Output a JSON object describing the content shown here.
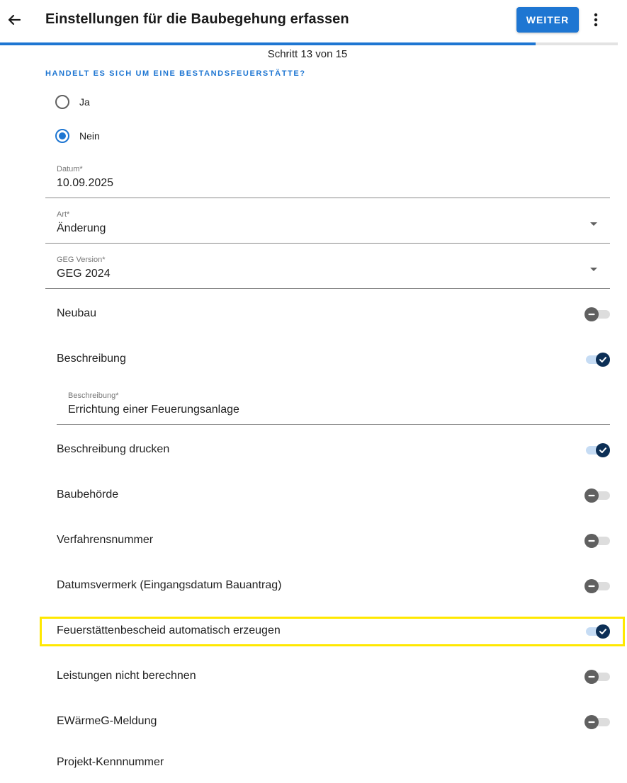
{
  "header": {
    "title": "Einstellungen für die Baubegehung erfassen",
    "weiter_label": "WEITER"
  },
  "progress": {
    "current": 13,
    "total": 15,
    "step_text": "Schritt 13 von 15"
  },
  "question": {
    "label": "HANDELT ES SICH UM EINE BESTANDSFEUERSTÄTTE?",
    "options": [
      {
        "label": "Ja",
        "selected": false
      },
      {
        "label": "Nein",
        "selected": true
      }
    ]
  },
  "fields": {
    "datum": {
      "label": "Datum*",
      "value": "10.09.2025"
    },
    "art": {
      "label": "Art*",
      "value": "Änderung"
    },
    "geg": {
      "label": "GEG Version*",
      "value": "GEG 2024"
    },
    "beschreibung": {
      "label": "Beschreibung*",
      "value": "Errichtung einer Feuerungsanlage"
    }
  },
  "toggles": [
    {
      "label": "Neubau",
      "on": false
    },
    {
      "label": "Beschreibung",
      "on": true
    },
    {
      "label": "Beschreibung drucken",
      "on": true
    },
    {
      "label": "Baubehörde",
      "on": false
    },
    {
      "label": "Verfahrensnummer",
      "on": false
    },
    {
      "label": "Datumsvermerk (Eingangsdatum Bauantrag)",
      "on": false
    },
    {
      "label": "Feuerstättenbescheid automatisch erzeugen",
      "on": true
    },
    {
      "label": "Leistungen nicht berechnen",
      "on": false
    },
    {
      "label": "EWärmeG-Meldung",
      "on": false
    }
  ],
  "last_item": {
    "label": "Projekt-Kennnummer"
  },
  "colors": {
    "accent": "#1e76d2",
    "toggle_on_knob": "#0c2f56",
    "highlight": "#ffe800"
  },
  "icons": {
    "back": "arrow-left-icon",
    "more": "more-vert-icon",
    "check": "check-icon",
    "minus": "minus-icon",
    "dropdown": "caret-down-icon"
  }
}
